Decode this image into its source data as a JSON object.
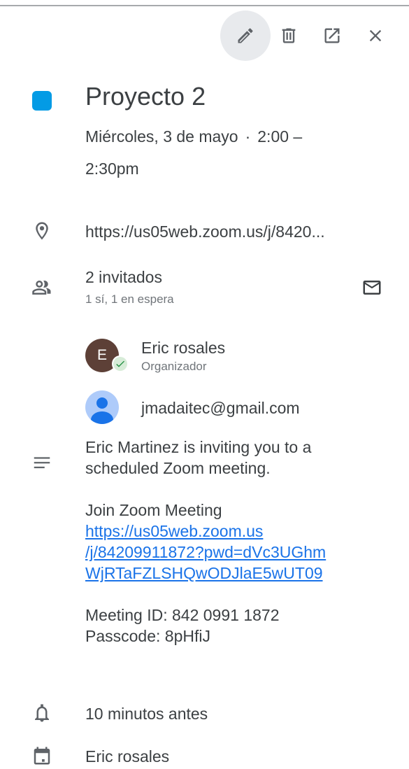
{
  "toolbar": {
    "edit_icon": "pencil-icon",
    "delete_icon": "trash-icon",
    "open_icon": "open-in-new-icon",
    "close_icon": "close-icon"
  },
  "event": {
    "color": "#039be5",
    "title": "Proyecto 2",
    "date": "Miércoles, 3 de mayo",
    "separator": "·",
    "time_start": "2:00 –",
    "time_end": "2:30pm",
    "location": "https://us05web.zoom.us/j/8420..."
  },
  "guests": {
    "summary": "2 invitados",
    "status": "1 sí, 1 en espera",
    "list": [
      {
        "initial": "E",
        "name": "Eric rosales",
        "role": "Organizador"
      },
      {
        "email": "jmadaitec@gmail.com"
      }
    ]
  },
  "description": {
    "intro_line1": "Eric Martinez is inviting you to a",
    "intro_line2": "scheduled Zoom meeting.",
    "join_label": "Join Zoom Meeting",
    "link_line1": "https://us05web.zoom.us",
    "link_line2": "/j/84209911872?pwd=dVc3UGhm",
    "link_line3": "WjRTaFZLSHQwODJlaE5wUT09",
    "meeting_id": "Meeting ID: 842 0991 1872",
    "passcode": "Passcode: 8pHfiJ"
  },
  "reminder": "10 minutos antes",
  "calendar_owner": "Eric rosales"
}
